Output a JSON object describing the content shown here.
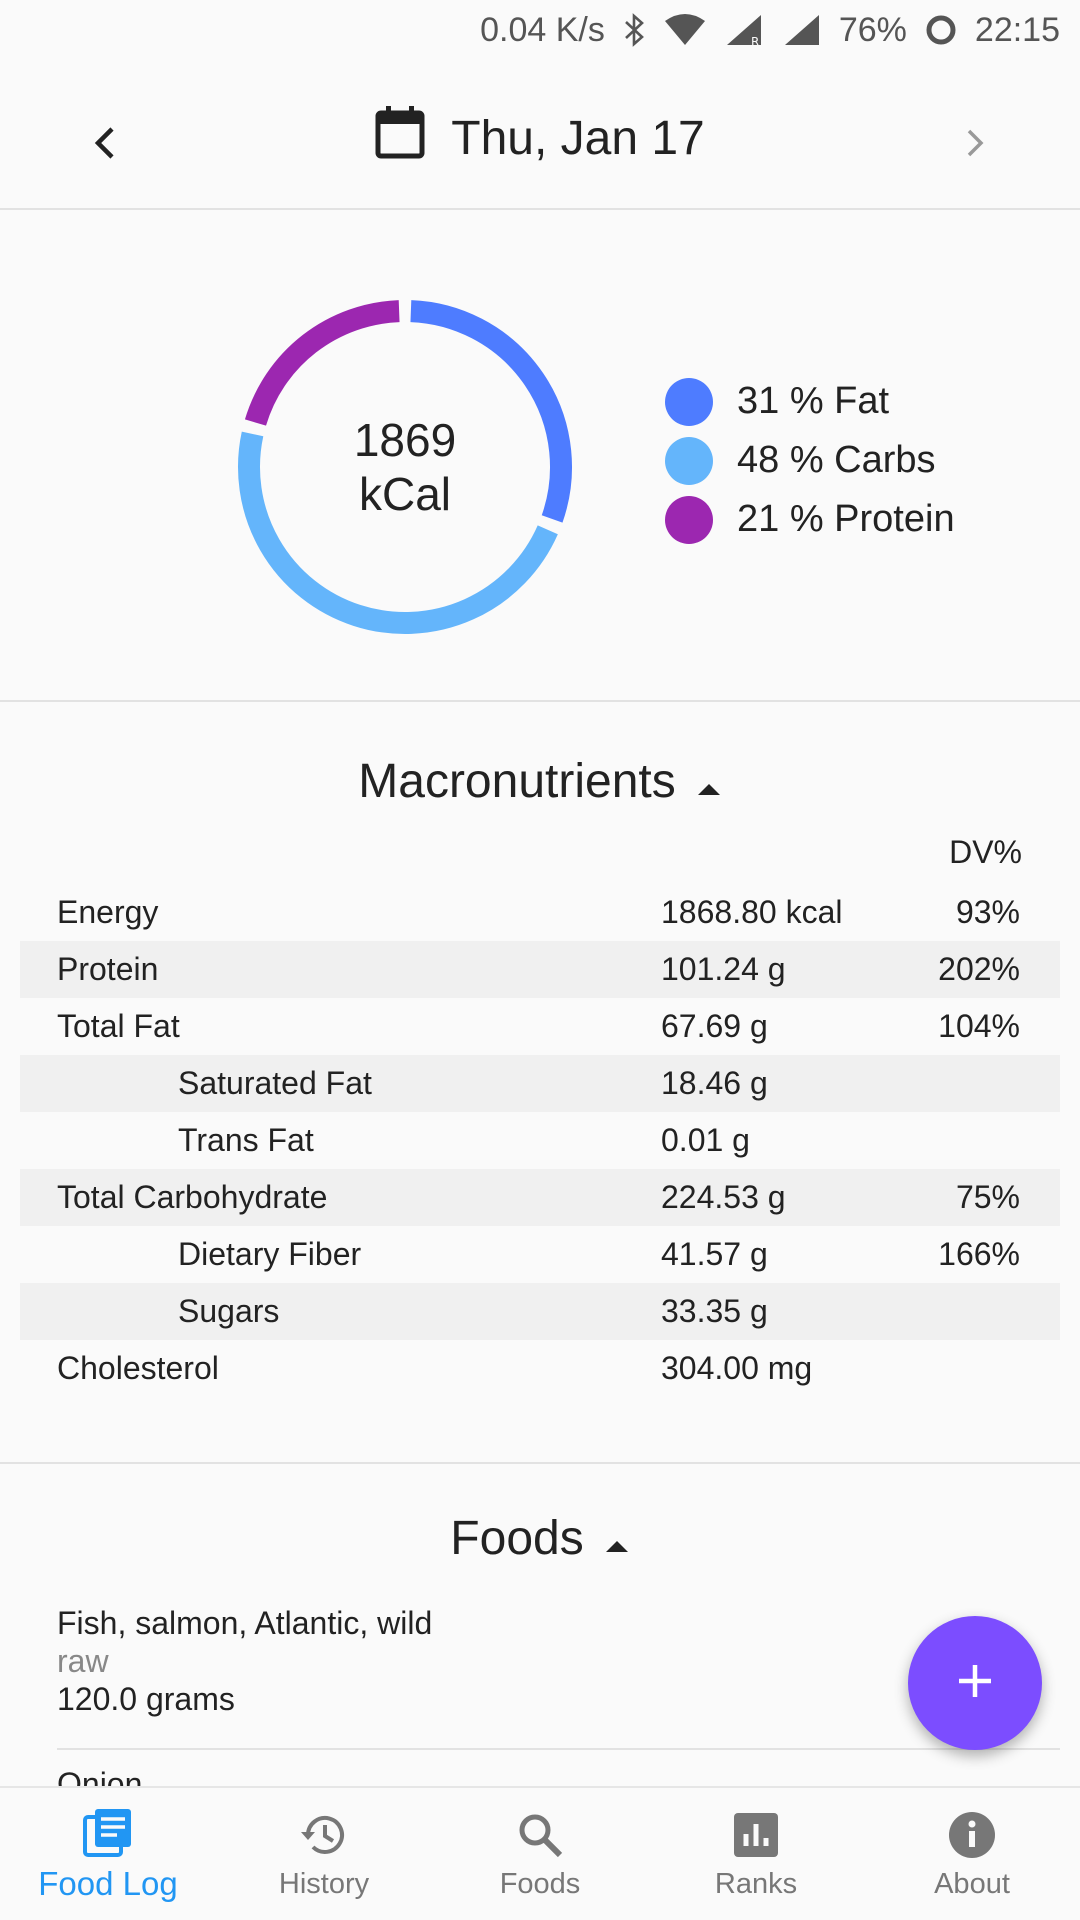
{
  "status_bar": {
    "net_speed": "0.04 K/s",
    "battery": "76%",
    "time": "22:15",
    "icons": [
      "bluetooth-icon",
      "wifi-icon",
      "signal-roaming-icon",
      "signal-icon",
      "battery-ring-icon"
    ]
  },
  "header": {
    "date": "Thu, Jan 17",
    "icons": {
      "prev": "chevron-left-icon",
      "next": "chevron-right-icon",
      "calendar": "calendar-icon"
    }
  },
  "summary": {
    "kcal_value": "1869",
    "kcal_unit": "kCal",
    "legend": [
      {
        "label": "31 % Fat",
        "color": "#4e7cff"
      },
      {
        "label": "48 % Carbs",
        "color": "#64b5fb"
      },
      {
        "label": "21 % Protein",
        "color": "#9c27b0"
      }
    ],
    "chart_data": {
      "type": "pie",
      "categories": [
        "Fat",
        "Carbs",
        "Protein"
      ],
      "values": [
        31,
        48,
        21
      ],
      "title": "",
      "center_label": "1869 kCal",
      "colors": [
        "#4e7cff",
        "#64b5fb",
        "#9c27b0"
      ]
    }
  },
  "macros": {
    "title": "Macronutrients",
    "dv_header": "DV%",
    "rows": [
      {
        "name": "Energy",
        "value": "1868.80 kcal",
        "dv": "93%"
      },
      {
        "name": "Protein",
        "value": "101.24 g",
        "dv": "202%"
      },
      {
        "name": "Total Fat",
        "value": "67.69 g",
        "dv": "104%"
      },
      {
        "name": "Saturated Fat",
        "value": "18.46 g",
        "dv": ""
      },
      {
        "name": "Trans Fat",
        "value": "0.01 g",
        "dv": ""
      },
      {
        "name": "Total Carbohydrate",
        "value": "224.53 g",
        "dv": "75%"
      },
      {
        "name": "Dietary Fiber",
        "value": "41.57 g",
        "dv": "166%"
      },
      {
        "name": "Sugars",
        "value": "33.35 g",
        "dv": ""
      },
      {
        "name": "Cholesterol",
        "value": "304.00 mg",
        "dv": ""
      }
    ]
  },
  "foods": {
    "title": "Foods",
    "items": [
      {
        "name": "Fish, salmon, Atlantic, wild",
        "prep": "raw",
        "qty": "120.0 grams"
      }
    ],
    "next_partial": "Onion"
  },
  "fab": {
    "icon": "plus-icon"
  },
  "bottom_nav": [
    {
      "label": "Food Log",
      "icon": "food-log-icon",
      "active": true
    },
    {
      "label": "History",
      "icon": "history-icon",
      "active": false
    },
    {
      "label": "Foods",
      "icon": "search-icon",
      "active": false
    },
    {
      "label": "Ranks",
      "icon": "ranks-icon",
      "active": false
    },
    {
      "label": "About",
      "icon": "info-icon",
      "active": false
    }
  ]
}
